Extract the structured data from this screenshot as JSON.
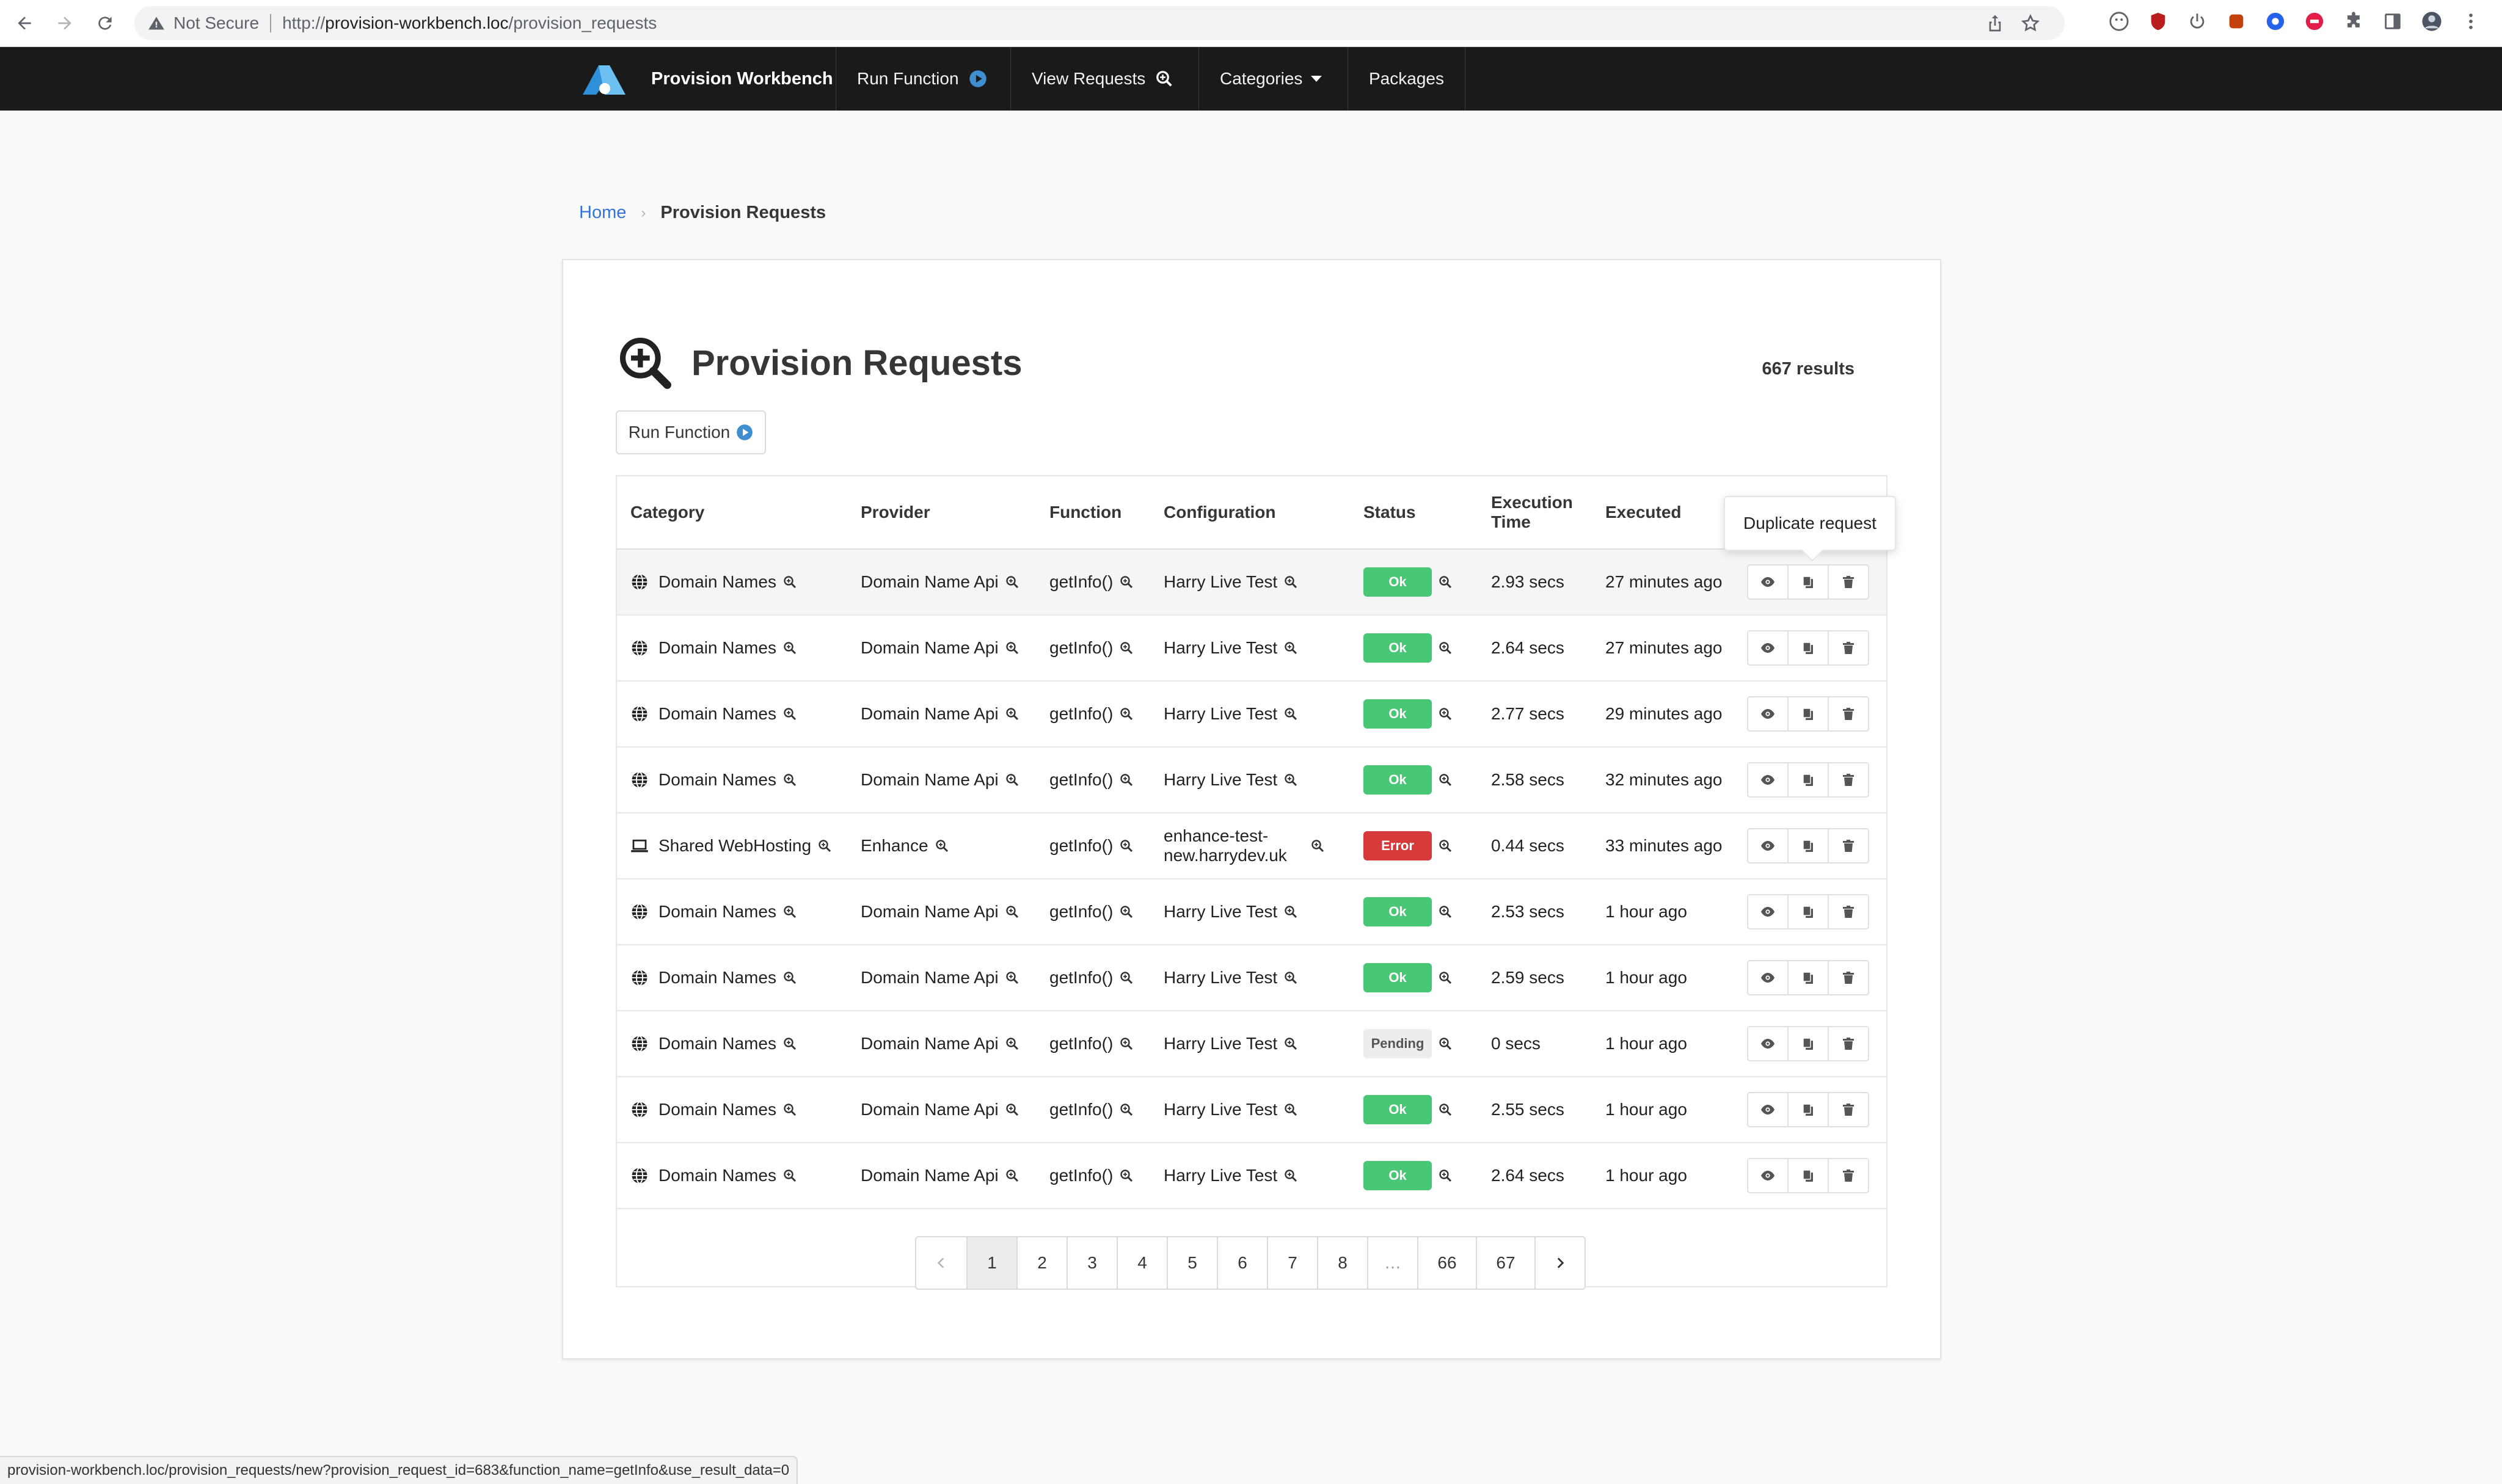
{
  "browser": {
    "not_secure": "Not Secure",
    "url_prefix": "http://",
    "url_host": "provision-workbench.loc",
    "url_path": "/provision_requests",
    "status_url": "provision-workbench.loc/provision_requests/new?provision_request_id=683&function_name=getInfo&use_result_data=0"
  },
  "navbar": {
    "brand": "Provision Workbench",
    "run_function": "Run Function",
    "view_requests": "View Requests",
    "categories": "Categories",
    "packages": "Packages"
  },
  "breadcrumb": {
    "home": "Home",
    "current": "Provision Requests"
  },
  "page": {
    "title": "Provision Requests",
    "results": "667 results",
    "run_function_button": "Run Function"
  },
  "table": {
    "headers": {
      "category": "Category",
      "provider": "Provider",
      "function": "Function",
      "configuration": "Configuration",
      "status": "Status",
      "execution_time": "Execution Time",
      "executed": "Executed"
    },
    "rows": [
      {
        "category": "Domain Names",
        "category_icon": "globe-icon",
        "provider": "Domain Name Api",
        "function": "getInfo()",
        "configuration": "Harry Live Test",
        "status": "Ok",
        "exec_time": "2.93 secs",
        "executed": "27 minutes ago"
      },
      {
        "category": "Domain Names",
        "category_icon": "globe-icon",
        "provider": "Domain Name Api",
        "function": "getInfo()",
        "configuration": "Harry Live Test",
        "status": "Ok",
        "exec_time": "2.64 secs",
        "executed": "27 minutes ago"
      },
      {
        "category": "Domain Names",
        "category_icon": "globe-icon",
        "provider": "Domain Name Api",
        "function": "getInfo()",
        "configuration": "Harry Live Test",
        "status": "Ok",
        "exec_time": "2.77 secs",
        "executed": "29 minutes ago"
      },
      {
        "category": "Domain Names",
        "category_icon": "globe-icon",
        "provider": "Domain Name Api",
        "function": "getInfo()",
        "configuration": "Harry Live Test",
        "status": "Ok",
        "exec_time": "2.58 secs",
        "executed": "32 minutes ago"
      },
      {
        "category": "Shared WebHosting",
        "category_icon": "laptop-icon",
        "provider": "Enhance",
        "function": "getInfo()",
        "configuration": "enhance-test-new.harrydev.uk",
        "status": "Error",
        "exec_time": "0.44 secs",
        "executed": "33 minutes ago"
      },
      {
        "category": "Domain Names",
        "category_icon": "globe-icon",
        "provider": "Domain Name Api",
        "function": "getInfo()",
        "configuration": "Harry Live Test",
        "status": "Ok",
        "exec_time": "2.53 secs",
        "executed": "1 hour ago"
      },
      {
        "category": "Domain Names",
        "category_icon": "globe-icon",
        "provider": "Domain Name Api",
        "function": "getInfo()",
        "configuration": "Harry Live Test",
        "status": "Ok",
        "exec_time": "2.59 secs",
        "executed": "1 hour ago"
      },
      {
        "category": "Domain Names",
        "category_icon": "globe-icon",
        "provider": "Domain Name Api",
        "function": "getInfo()",
        "configuration": "Harry Live Test",
        "status": "Pending",
        "exec_time": "0 secs",
        "executed": "1 hour ago"
      },
      {
        "category": "Domain Names",
        "category_icon": "globe-icon",
        "provider": "Domain Name Api",
        "function": "getInfo()",
        "configuration": "Harry Live Test",
        "status": "Ok",
        "exec_time": "2.55 secs",
        "executed": "1 hour ago"
      },
      {
        "category": "Domain Names",
        "category_icon": "globe-icon",
        "provider": "Domain Name Api",
        "function": "getInfo()",
        "configuration": "Harry Live Test",
        "status": "Ok",
        "exec_time": "2.64 secs",
        "executed": "1 hour ago"
      }
    ]
  },
  "pagination": {
    "pages": [
      "1",
      "2",
      "3",
      "4",
      "5",
      "6",
      "7",
      "8",
      "…",
      "66",
      "67"
    ],
    "current": "1"
  },
  "tooltip": "Duplicate request",
  "colors": {
    "navbar": "#1a1a1a",
    "ok": "#48c774",
    "error": "#d63a3a",
    "pending": "#ededed",
    "link": "#3273dc",
    "accent": "#3e8ed0"
  }
}
